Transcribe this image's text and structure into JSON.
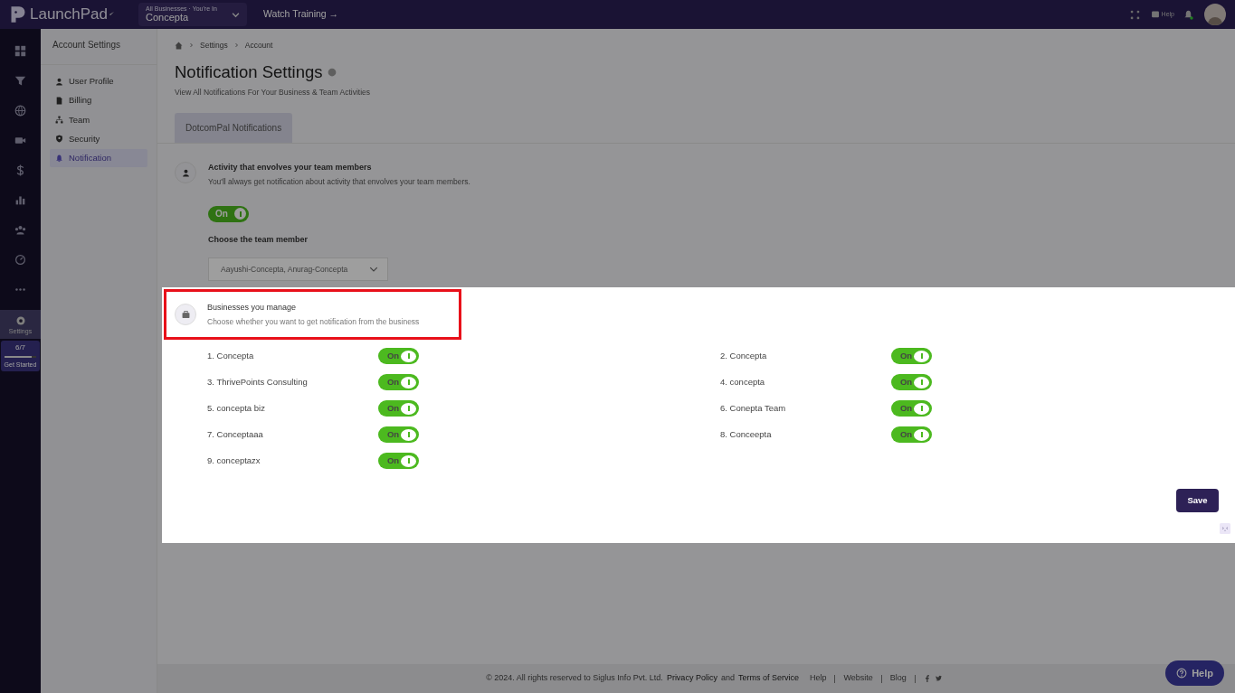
{
  "topbar": {
    "logo": "LaunchPad",
    "business_select": {
      "caption": "All Businesses · You're In",
      "value": "Concepta"
    },
    "watch_training": "Watch Training →",
    "help": "Help"
  },
  "rail": {
    "items": [
      {
        "kind": "grid"
      },
      {
        "kind": "funnel"
      },
      {
        "kind": "globe"
      },
      {
        "kind": "video"
      },
      {
        "kind": "dollar"
      },
      {
        "kind": "chart"
      },
      {
        "kind": "people"
      },
      {
        "kind": "gauge"
      },
      {
        "kind": "more"
      }
    ],
    "settings": {
      "label": "Settings",
      "selected": true
    },
    "progress": {
      "reading": "6/7",
      "level": 0.86,
      "label": "Get Started"
    }
  },
  "account_settings": {
    "title": "Account Settings",
    "items": [
      {
        "label": "User Profile",
        "kind": "user",
        "selected": false
      },
      {
        "label": "Billing",
        "kind": "billing",
        "selected": false
      },
      {
        "label": "Team",
        "kind": "team",
        "selected": false
      },
      {
        "label": "Security",
        "kind": "shield",
        "selected": false
      },
      {
        "label": "Notification",
        "kind": "bell",
        "selected": true
      }
    ]
  },
  "breadcrumb": [
    "Settings",
    "Account"
  ],
  "page": {
    "title": "Notification Settings",
    "subtitle": "View All Notifications For Your Business & Team Activities"
  },
  "tabs": [
    {
      "label": "DotcomPal Notifications",
      "selected": true
    }
  ],
  "team_activity": {
    "title": "Activity that envolves your team members",
    "description": "You'll always get notification about activity that envolves your team members.",
    "toggle": {
      "label": "On",
      "on": true
    },
    "choose_label": "Choose the team member",
    "select_value": "Aayushi-Concepta, Anurag-Concepta"
  },
  "businesses": {
    "title": "Businesses you manage",
    "description": "Choose whether you want to get notification from the business",
    "items": [
      {
        "label": "1. Concepta",
        "toggle": "On",
        "on": true
      },
      {
        "label": "2. Concepta",
        "toggle": "On",
        "on": true
      },
      {
        "label": "3. ThrivePoints Consulting",
        "toggle": "On",
        "on": true
      },
      {
        "label": "4. concepta",
        "toggle": "On",
        "on": true
      },
      {
        "label": "5. concepta biz",
        "toggle": "On",
        "on": true
      },
      {
        "label": "6. Conepta Team",
        "toggle": "On",
        "on": true
      },
      {
        "label": "7. Conceptaaa",
        "toggle": "On",
        "on": true
      },
      {
        "label": "8. Conceepta",
        "toggle": "On",
        "on": true
      },
      {
        "label": "9. conceptazx",
        "toggle": "On",
        "on": true
      }
    ],
    "save": "Save"
  },
  "footer": {
    "copyright": "© 2024. All rights reserved to Siglus Info Pvt. Ltd.",
    "privacy": "Privacy Policy",
    "and": "and",
    "terms": "Terms of Service",
    "links": [
      "Help",
      "Website",
      "Blog"
    ]
  },
  "help_button": "Help"
}
